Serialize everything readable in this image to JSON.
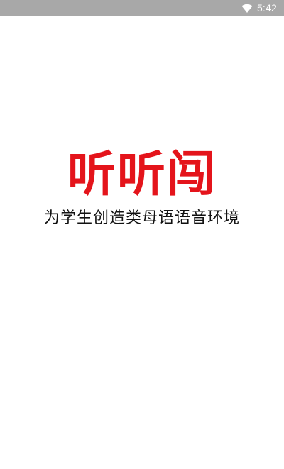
{
  "status_bar": {
    "time": "5:42",
    "icons": [
      "wifi-icon"
    ]
  },
  "splash": {
    "title": "听听闯",
    "tagline": "为学生创造类母语语音环境",
    "title_color": "#e4141b"
  }
}
